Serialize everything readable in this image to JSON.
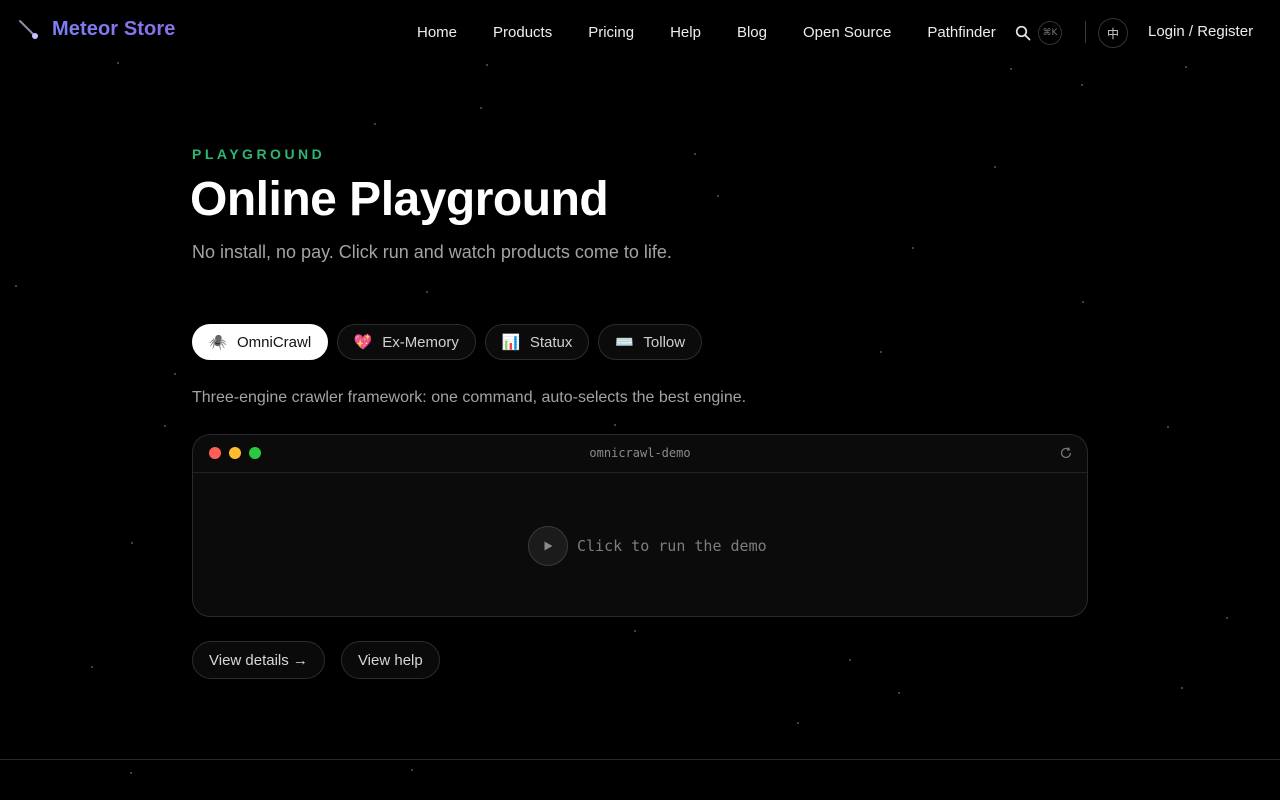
{
  "header": {
    "brand": "Meteor Store",
    "brand_icon": "meteor-icon",
    "nav": [
      "Home",
      "Products",
      "Pricing",
      "Help",
      "Blog",
      "Open Source",
      "Pathfinder"
    ],
    "search_icon": "search-icon",
    "search_shortcut": "⌘K",
    "language_toggle": "中",
    "login": "Login / Register"
  },
  "hero": {
    "eyebrow": "PLAYGROUND",
    "title": "Online Playground",
    "subtitle": "No install, no pay. Click run and watch products come to life."
  },
  "products": {
    "tabs": [
      {
        "label": "OmniCrawl",
        "icon": "🕷️",
        "active": true
      },
      {
        "label": "Ex-Memory",
        "icon": "💖",
        "active": false
      },
      {
        "label": "Statux",
        "icon": "📊",
        "active": false
      },
      {
        "label": "Tollow",
        "icon": "⌨️",
        "active": false
      }
    ],
    "description": "Three-engine crawler framework: one command, auto-selects the best engine."
  },
  "terminal": {
    "title": "omnicrawl-demo",
    "run_label": "Click to run the demo",
    "window_dots": [
      "#ff5f57",
      "#febc2e",
      "#28c840"
    ]
  },
  "actions": {
    "details": "View details →",
    "help": "View help"
  },
  "colors": {
    "accent_green": "#2bb673",
    "brand_gradient_start": "#7c7ff7",
    "brand_gradient_end": "#8b6fe8",
    "background": "#000000"
  }
}
